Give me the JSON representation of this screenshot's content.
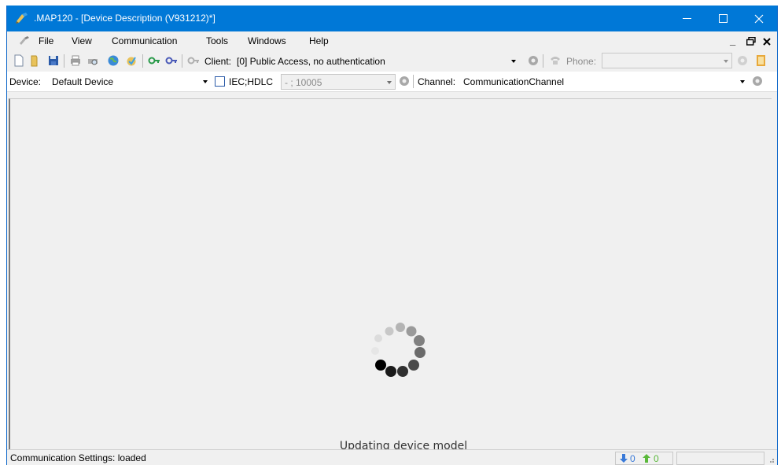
{
  "window": {
    "title": ".MAP120 - [Device Description (V931212)*]",
    "accent_color": "#0078d7"
  },
  "menu": {
    "items": [
      "File",
      "View",
      "Communication",
      "Tools",
      "Windows",
      "Help"
    ]
  },
  "toolbar": {
    "client_label": "Client:",
    "client_value": "[0] Public Access, no authentication",
    "phone_label": "Phone:",
    "phone_value": ""
  },
  "device_bar": {
    "device_label": "Device:",
    "device_value": "Default Device",
    "protocol_label": "IEC;HDLC",
    "protocol_checked": false,
    "address_value": "- ; 10005",
    "channel_label": "Channel:",
    "channel_value": "CommunicationChannel"
  },
  "main": {
    "loading_text": "Updating device model"
  },
  "status": {
    "text": "Communication Settings: loaded",
    "down_count": "0",
    "up_count": "0"
  }
}
